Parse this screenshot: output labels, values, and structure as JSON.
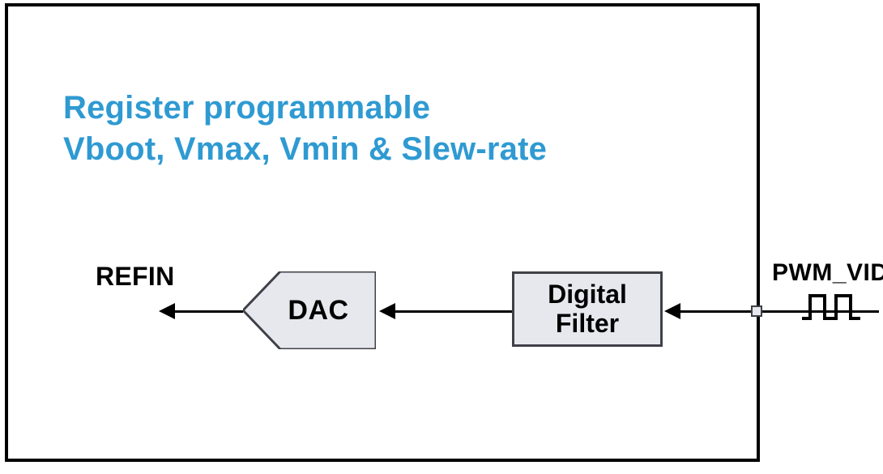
{
  "title_line1": "Register programmable",
  "title_line2": "Vboot, Vmax, Vmin & Slew-rate",
  "labels": {
    "refin": "REFIN",
    "pwm_vid": "PWM_VID"
  },
  "blocks": {
    "dac": "DAC",
    "digital_filter_line1": "Digital",
    "digital_filter_line2": "Filter"
  },
  "colors": {
    "accent": "#2f9ad2",
    "block_bg": "#e7e8ee",
    "stroke": "#404048"
  }
}
